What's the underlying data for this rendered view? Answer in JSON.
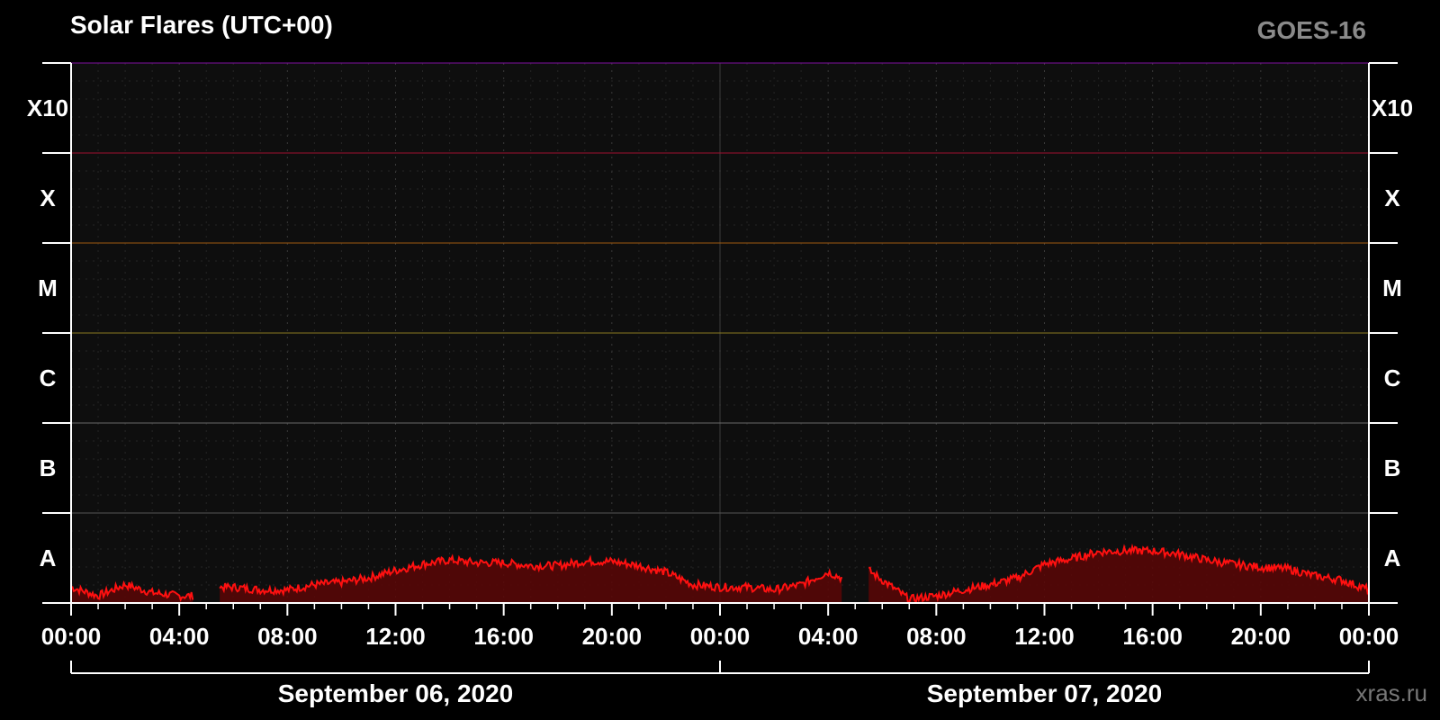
{
  "header": {
    "title": "Solar Flares (UTC+00)",
    "satellite": "GOES-16",
    "credit": "xras.ru"
  },
  "chart_data": {
    "type": "area",
    "title": "Solar Flares (UTC+00)",
    "y_scale": "log",
    "y_classes": [
      {
        "label": "A",
        "flux": 1e-08,
        "color": "#555555"
      },
      {
        "label": "B",
        "flux": 1e-07,
        "color": "#6a6a6a"
      },
      {
        "label": "C",
        "flux": 1e-06,
        "color": "#8a7a20"
      },
      {
        "label": "M",
        "flux": 1e-05,
        "color": "#a05a10"
      },
      {
        "label": "X",
        "flux": 0.0001,
        "color": "#a01030"
      },
      {
        "label": "X10",
        "flux": 0.001,
        "color": "#8010a0"
      }
    ],
    "ylim": [
      1e-08,
      0.01
    ],
    "x_tick_labels": [
      "00:00",
      "04:00",
      "08:00",
      "12:00",
      "16:00",
      "20:00",
      "00:00",
      "04:00",
      "08:00",
      "12:00",
      "16:00",
      "20:00",
      "00:00"
    ],
    "date_labels": [
      "September 06, 2020",
      "September 07, 2020"
    ],
    "series": [
      {
        "name": "",
        "color": "#ff1010",
        "x_hours": [
          0,
          1,
          2,
          3,
          4,
          4.5,
          5.5,
          6,
          7,
          8,
          9,
          10,
          11,
          12,
          13,
          14,
          15,
          16,
          17,
          18,
          19,
          20,
          21,
          22,
          23,
          24,
          25,
          26,
          27,
          28,
          28.5,
          29.5,
          30,
          31,
          32,
          33,
          34,
          35,
          36,
          37,
          38,
          39,
          40,
          41,
          42,
          43,
          44,
          45,
          46,
          47,
          48
        ],
        "flux": [
          1.5e-08,
          1.2e-08,
          1.6e-08,
          1.3e-08,
          1.2e-08,
          1.2e-08,
          1.5e-08,
          1.5e-08,
          1.4e-08,
          1.4e-08,
          1.6e-08,
          1.7e-08,
          1.9e-08,
          2.3e-08,
          2.7e-08,
          3e-08,
          2.8e-08,
          2.8e-08,
          2.6e-08,
          2.6e-08,
          2.9e-08,
          2.9e-08,
          2.6e-08,
          2.2e-08,
          1.6e-08,
          1.5e-08,
          1.5e-08,
          1.4e-08,
          1.6e-08,
          2.2e-08,
          1.9e-08,
          2.3e-08,
          1.8e-08,
          1.1e-08,
          1.2e-08,
          1.4e-08,
          1.6e-08,
          1.9e-08,
          2.7e-08,
          3.1e-08,
          3.7e-08,
          3.8e-08,
          3.8e-08,
          3.5e-08,
          3e-08,
          2.7e-08,
          2.5e-08,
          2.4e-08,
          2e-08,
          1.8e-08,
          1.4e-08
        ],
        "gaps_hours": [
          [
            4.5,
            5.5
          ],
          [
            28.5,
            29.5
          ]
        ]
      }
    ]
  }
}
